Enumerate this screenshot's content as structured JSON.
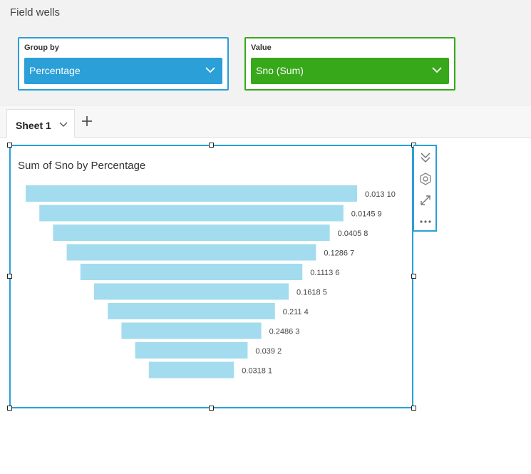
{
  "field_wells": {
    "title": "Field wells",
    "group_by": {
      "label": "Group by",
      "field": "Percentage"
    },
    "value": {
      "label": "Value",
      "field": "Sno (Sum)"
    }
  },
  "sheet_tabs": {
    "tabs": [
      {
        "label": "Sheet 1"
      }
    ],
    "add_icon": "plus-icon"
  },
  "visual": {
    "title": "Sum of Sno by Percentage",
    "toolbar_icons": [
      "double-chevron-down-icon",
      "gear-icon",
      "expand-icon",
      "more-icon"
    ]
  },
  "colors": {
    "group_by_accent": "#2a9fd8",
    "value_accent": "#37a81a",
    "bar": "#a3dcee",
    "selection_border": "#2a9fd8"
  },
  "chart_data": {
    "type": "bar",
    "subtype": "funnel",
    "title": "Sum of Sno by Percentage",
    "categories": [
      "0.013",
      "0.0145",
      "0.0405",
      "0.1286",
      "0.1113",
      "0.1618",
      "0.211",
      "0.2486",
      "0.039",
      "0.0318"
    ],
    "values": [
      10,
      9,
      8,
      7,
      6,
      5,
      4,
      3,
      2,
      1
    ],
    "labels": [
      "0.013 10",
      "0.0145 9",
      "0.0405 8",
      "0.1286 7",
      "0.1113 6",
      "0.1618 5",
      "0.211 4",
      "0.2486 3",
      "0.039 2",
      "0.0318 1"
    ]
  }
}
